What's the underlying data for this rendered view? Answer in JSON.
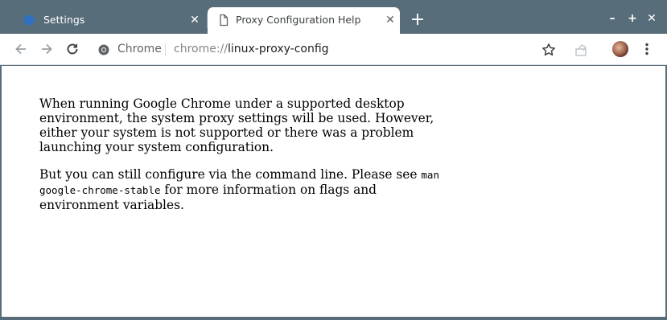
{
  "tabs": [
    {
      "title": "Settings",
      "icon": "gear-icon",
      "active": false
    },
    {
      "title": "Proxy Configuration Help",
      "icon": "document-icon",
      "active": true
    }
  ],
  "toolbar": {
    "site_chip_label": "Chrome",
    "url_scheme": "chrome://",
    "url_path": "linux-proxy-config"
  },
  "content": {
    "paragraph1": "When running Google Chrome under a supported desktop environment, the system proxy settings will be used. However, either your system is not supported or there was a problem launching your system configuration.",
    "paragraph2_before": "But you can still configure via the command line. Please see ",
    "paragraph2_code": "man google-chrome-stable",
    "paragraph2_after": " for more information on flags and environment variables."
  },
  "colors": {
    "frame": "#576d7a",
    "settings_icon": "#1a73e8"
  }
}
